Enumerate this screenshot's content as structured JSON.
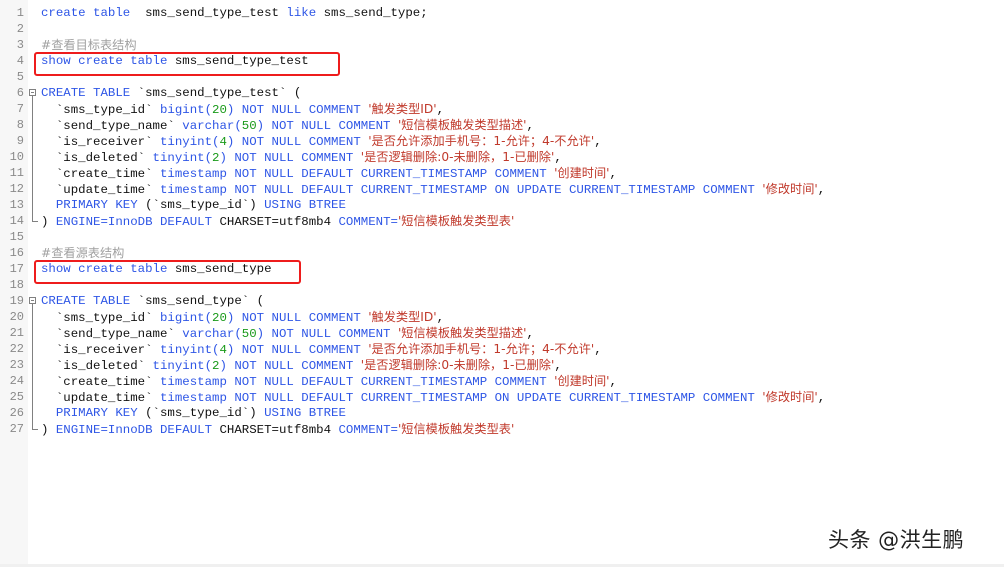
{
  "editor": {
    "language": "SQL",
    "lines": [
      {
        "n": "1",
        "tokens": [
          [
            "kw",
            "create table  "
          ],
          [
            "id",
            "sms_send_type_test "
          ],
          [
            "kw",
            "like "
          ],
          [
            "id",
            "sms_send_type;"
          ]
        ]
      },
      {
        "n": "2",
        "tokens": []
      },
      {
        "n": "3",
        "tokens": [
          [
            "cmt",
            "#查看目标表结构"
          ]
        ]
      },
      {
        "n": "4",
        "tokens": [
          [
            "kw",
            "show create table "
          ],
          [
            "id",
            "sms_send_type_test"
          ]
        ]
      },
      {
        "n": "5",
        "tokens": []
      },
      {
        "n": "6",
        "tokens": [
          [
            "kw",
            "CREATE TABLE "
          ],
          [
            "id",
            "`sms_send_type_test` ("
          ]
        ]
      },
      {
        "n": "7",
        "tokens": [
          [
            "id",
            "  `sms_type_id` "
          ],
          [
            "kw",
            "bigint("
          ],
          [
            "num",
            "20"
          ],
          [
            "kw",
            ") NOT NULL COMMENT "
          ],
          [
            "str",
            "'触发类型ID'"
          ],
          [
            "id",
            ","
          ]
        ]
      },
      {
        "n": "8",
        "tokens": [
          [
            "id",
            "  `send_type_name` "
          ],
          [
            "kw",
            "varchar("
          ],
          [
            "num",
            "50"
          ],
          [
            "kw",
            ") NOT NULL COMMENT "
          ],
          [
            "str",
            "'短信模板触发类型描述'"
          ],
          [
            "id",
            ","
          ]
        ]
      },
      {
        "n": "9",
        "tokens": [
          [
            "id",
            "  `is_receiver` "
          ],
          [
            "kw",
            "tinyint("
          ],
          [
            "num",
            "4"
          ],
          [
            "kw",
            ") NOT NULL COMMENT "
          ],
          [
            "str",
            "'是否允许添加手机号：1-允许；4-不允许'"
          ],
          [
            "id",
            ","
          ]
        ]
      },
      {
        "n": "10",
        "tokens": [
          [
            "id",
            "  `is_deleted` "
          ],
          [
            "kw",
            "tinyint("
          ],
          [
            "num",
            "2"
          ],
          [
            "kw",
            ") NOT NULL COMMENT "
          ],
          [
            "str",
            "'是否逻辑删除:0-未删除，1-已删除'"
          ],
          [
            "id",
            ","
          ]
        ]
      },
      {
        "n": "11",
        "tokens": [
          [
            "id",
            "  `create_time` "
          ],
          [
            "kw",
            "timestamp NOT NULL DEFAULT CURRENT_TIMESTAMP COMMENT "
          ],
          [
            "str",
            "'创建时间'"
          ],
          [
            "id",
            ","
          ]
        ]
      },
      {
        "n": "12",
        "tokens": [
          [
            "id",
            "  `update_time` "
          ],
          [
            "kw",
            "timestamp NOT NULL DEFAULT CURRENT_TIMESTAMP ON UPDATE CURRENT_TIMESTAMP COMMENT "
          ],
          [
            "str",
            "'修改时间'"
          ],
          [
            "id",
            ","
          ]
        ]
      },
      {
        "n": "13",
        "tokens": [
          [
            "kw",
            "  PRIMARY KEY "
          ],
          [
            "id",
            "(`sms_type_id`) "
          ],
          [
            "kw",
            "USING BTREE"
          ]
        ]
      },
      {
        "n": "14",
        "tokens": [
          [
            "id",
            ") "
          ],
          [
            "kw",
            "ENGINE=InnoDB DEFAULT "
          ],
          [
            "id",
            "CHARSET=utf8mb4 "
          ],
          [
            "kw",
            "COMMENT="
          ],
          [
            "str",
            "'短信模板触发类型表'"
          ]
        ]
      },
      {
        "n": "15",
        "tokens": []
      },
      {
        "n": "16",
        "tokens": [
          [
            "cmt",
            "#查看源表结构"
          ]
        ]
      },
      {
        "n": "17",
        "tokens": [
          [
            "kw",
            "show create table "
          ],
          [
            "id",
            "sms_send_type"
          ]
        ]
      },
      {
        "n": "18",
        "tokens": []
      },
      {
        "n": "19",
        "tokens": [
          [
            "kw",
            "CREATE TABLE "
          ],
          [
            "id",
            "`sms_send_type` ("
          ]
        ]
      },
      {
        "n": "20",
        "tokens": [
          [
            "id",
            "  `sms_type_id` "
          ],
          [
            "kw",
            "bigint("
          ],
          [
            "num",
            "20"
          ],
          [
            "kw",
            ") NOT NULL COMMENT "
          ],
          [
            "str",
            "'触发类型ID'"
          ],
          [
            "id",
            ","
          ]
        ]
      },
      {
        "n": "21",
        "tokens": [
          [
            "id",
            "  `send_type_name` "
          ],
          [
            "kw",
            "varchar("
          ],
          [
            "num",
            "50"
          ],
          [
            "kw",
            ") NOT NULL COMMENT "
          ],
          [
            "str",
            "'短信模板触发类型描述'"
          ],
          [
            "id",
            ","
          ]
        ]
      },
      {
        "n": "22",
        "tokens": [
          [
            "id",
            "  `is_receiver` "
          ],
          [
            "kw",
            "tinyint("
          ],
          [
            "num",
            "4"
          ],
          [
            "kw",
            ") NOT NULL COMMENT "
          ],
          [
            "str",
            "'是否允许添加手机号：1-允许；4-不允许'"
          ],
          [
            "id",
            ","
          ]
        ]
      },
      {
        "n": "23",
        "tokens": [
          [
            "id",
            "  `is_deleted` "
          ],
          [
            "kw",
            "tinyint("
          ],
          [
            "num",
            "2"
          ],
          [
            "kw",
            ") NOT NULL COMMENT "
          ],
          [
            "str",
            "'是否逻辑删除:0-未删除，1-已删除'"
          ],
          [
            "id",
            ","
          ]
        ]
      },
      {
        "n": "24",
        "tokens": [
          [
            "id",
            "  `create_time` "
          ],
          [
            "kw",
            "timestamp NOT NULL DEFAULT CURRENT_TIMESTAMP COMMENT "
          ],
          [
            "str",
            "'创建时间'"
          ],
          [
            "id",
            ","
          ]
        ]
      },
      {
        "n": "25",
        "tokens": [
          [
            "id",
            "  `update_time` "
          ],
          [
            "kw",
            "timestamp NOT NULL DEFAULT CURRENT_TIMESTAMP ON UPDATE CURRENT_TIMESTAMP COMMENT "
          ],
          [
            "str",
            "'修改时间'"
          ],
          [
            "id",
            ","
          ]
        ]
      },
      {
        "n": "26",
        "tokens": [
          [
            "kw",
            "  PRIMARY KEY "
          ],
          [
            "id",
            "(`sms_type_id`) "
          ],
          [
            "kw",
            "USING BTREE"
          ]
        ]
      },
      {
        "n": "27",
        "tokens": [
          [
            "id",
            ") "
          ],
          [
            "kw",
            "ENGINE=InnoDB DEFAULT "
          ],
          [
            "id",
            "CHARSET=utf8mb4 "
          ],
          [
            "kw",
            "COMMENT="
          ],
          [
            "str",
            "'短信模板触发类型表'"
          ]
        ]
      }
    ],
    "highlighted_lines": [
      "4",
      "17"
    ],
    "fold_regions": [
      {
        "start": "6",
        "end": "14"
      },
      {
        "start": "19",
        "end": "27"
      }
    ]
  },
  "colors": {
    "keyword": "#2e56e6",
    "identifier": "#111111",
    "number": "#1a9a1a",
    "string": "#c0392b",
    "comment": "#a0a0a0",
    "highlight_box": "#ee1c1c"
  },
  "watermark": {
    "text": "头条 @洪生鹏"
  }
}
